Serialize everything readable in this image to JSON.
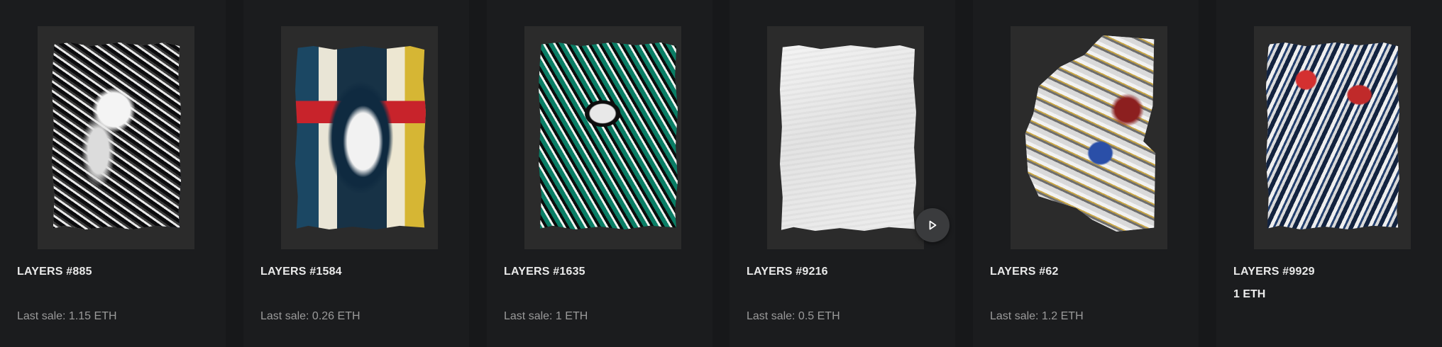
{
  "items": [
    {
      "title": "LAYERS #885",
      "price": "",
      "last_sale": "Last sale: 1.15 ETH"
    },
    {
      "title": "LAYERS #1584",
      "price": "",
      "last_sale": "Last sale: 0.26 ETH"
    },
    {
      "title": "LAYERS #1635",
      "price": "",
      "last_sale": "Last sale: 1 ETH"
    },
    {
      "title": "LAYERS #9216",
      "price": "",
      "last_sale": "Last sale: 0.5 ETH"
    },
    {
      "title": "LAYERS #62",
      "price": "",
      "last_sale": "Last sale: 1.2 ETH"
    },
    {
      "title": "LAYERS #9929",
      "price": "1 ETH",
      "last_sale": ""
    }
  ],
  "icons": {
    "play": "play-icon"
  },
  "colors": {
    "background": "#17181a",
    "card": "#1b1c1e",
    "media_frame": "#2b2b2b",
    "title_text": "#e9e9e9",
    "sale_text": "#9a9a9a",
    "play_button": "#3a3b3d"
  }
}
